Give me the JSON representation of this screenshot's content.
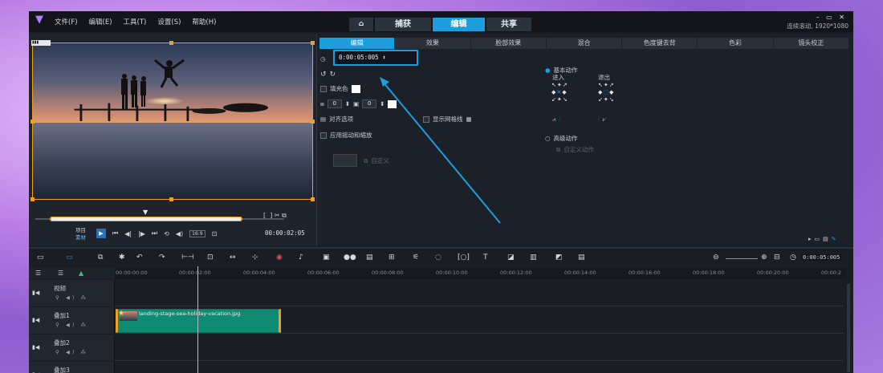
{
  "menu": {
    "items": [
      "文件(F)",
      "编辑(E)",
      "工具(T)",
      "设置(S)",
      "帮助(H)"
    ]
  },
  "mode_tabs": {
    "home_icon": "home-icon",
    "capture": "捕获",
    "edit": "编辑",
    "share": "共享"
  },
  "window": {
    "resolution": "连续滚动, 1920*1080"
  },
  "preview": {
    "project_label": "项目",
    "clip_label": "素材",
    "timecode": "00:00:02:05",
    "zoom_label": "16:9"
  },
  "options": {
    "tabs": [
      "编辑",
      "效果",
      "脸部效果",
      "混合",
      "色度键去背",
      "色彩",
      "镜头校正"
    ],
    "duration": "0:00:05:005",
    "fill_color_label": "填充色",
    "value_a": "0",
    "value_b": "0",
    "align_label": "对齐选项",
    "grid_label": "显示网格线",
    "pan_zoom_label": "应用摇动和缩放",
    "custom_label": "自定义",
    "basic_motion_label": "基本动作",
    "enter_label": "进入",
    "exit_label": "退出",
    "advanced_motion_label": "高级动作",
    "custom_motion_label": "自定义动作"
  },
  "timeline": {
    "timecode": "0:00:05:005",
    "ruler": [
      "00:00:00:00",
      "00:00:02:00",
      "00:00:04:00",
      "00:00:06:00",
      "00:00:08:00",
      "00:00:10:00",
      "00:00:12:00",
      "00:00:14:00",
      "00:00:16:00",
      "00:00:18:00",
      "00:00:20:00",
      "00:00:2"
    ],
    "tracks": [
      {
        "name": "视频"
      },
      {
        "name": "叠加1"
      },
      {
        "name": "叠加2"
      },
      {
        "name": "叠加3"
      }
    ],
    "clip_name": "landing-stage-sea-holiday-vacation.jpg"
  }
}
